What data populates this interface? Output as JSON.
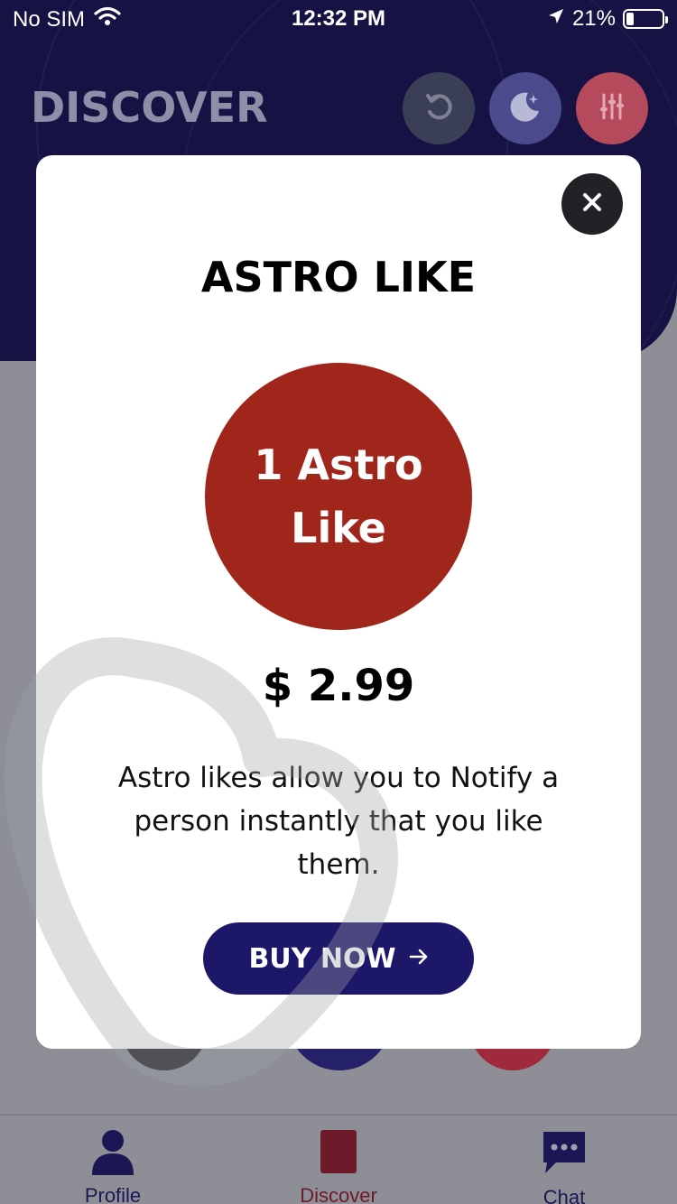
{
  "status_bar": {
    "carrier": "No SIM",
    "time": "12:32 PM",
    "battery_percent": "21%",
    "battery_level": 0.21
  },
  "header": {
    "title": "DISCOVER",
    "icons": [
      "undo-icon",
      "moon-icon",
      "filter-icon"
    ]
  },
  "modal": {
    "title": "ASTRO LIKE",
    "badge_text": "1 Astro Like",
    "price": "$ 2.99",
    "description": "Astro likes allow you to Notify a person instantly that you like them.",
    "buy_label": "BUY NOW",
    "close_icon": "close-icon"
  },
  "tabs": [
    {
      "label": "Profile",
      "icon": "person-icon"
    },
    {
      "label": "Discover",
      "icon": "card-icon"
    },
    {
      "label": "Chat",
      "icon": "chat-bubble-icon"
    }
  ],
  "colors": {
    "header_navy": "#1c1754",
    "badge_red": "#a0261c",
    "button_navy": "#1c1769",
    "active_tab": "#6e1a2a"
  }
}
